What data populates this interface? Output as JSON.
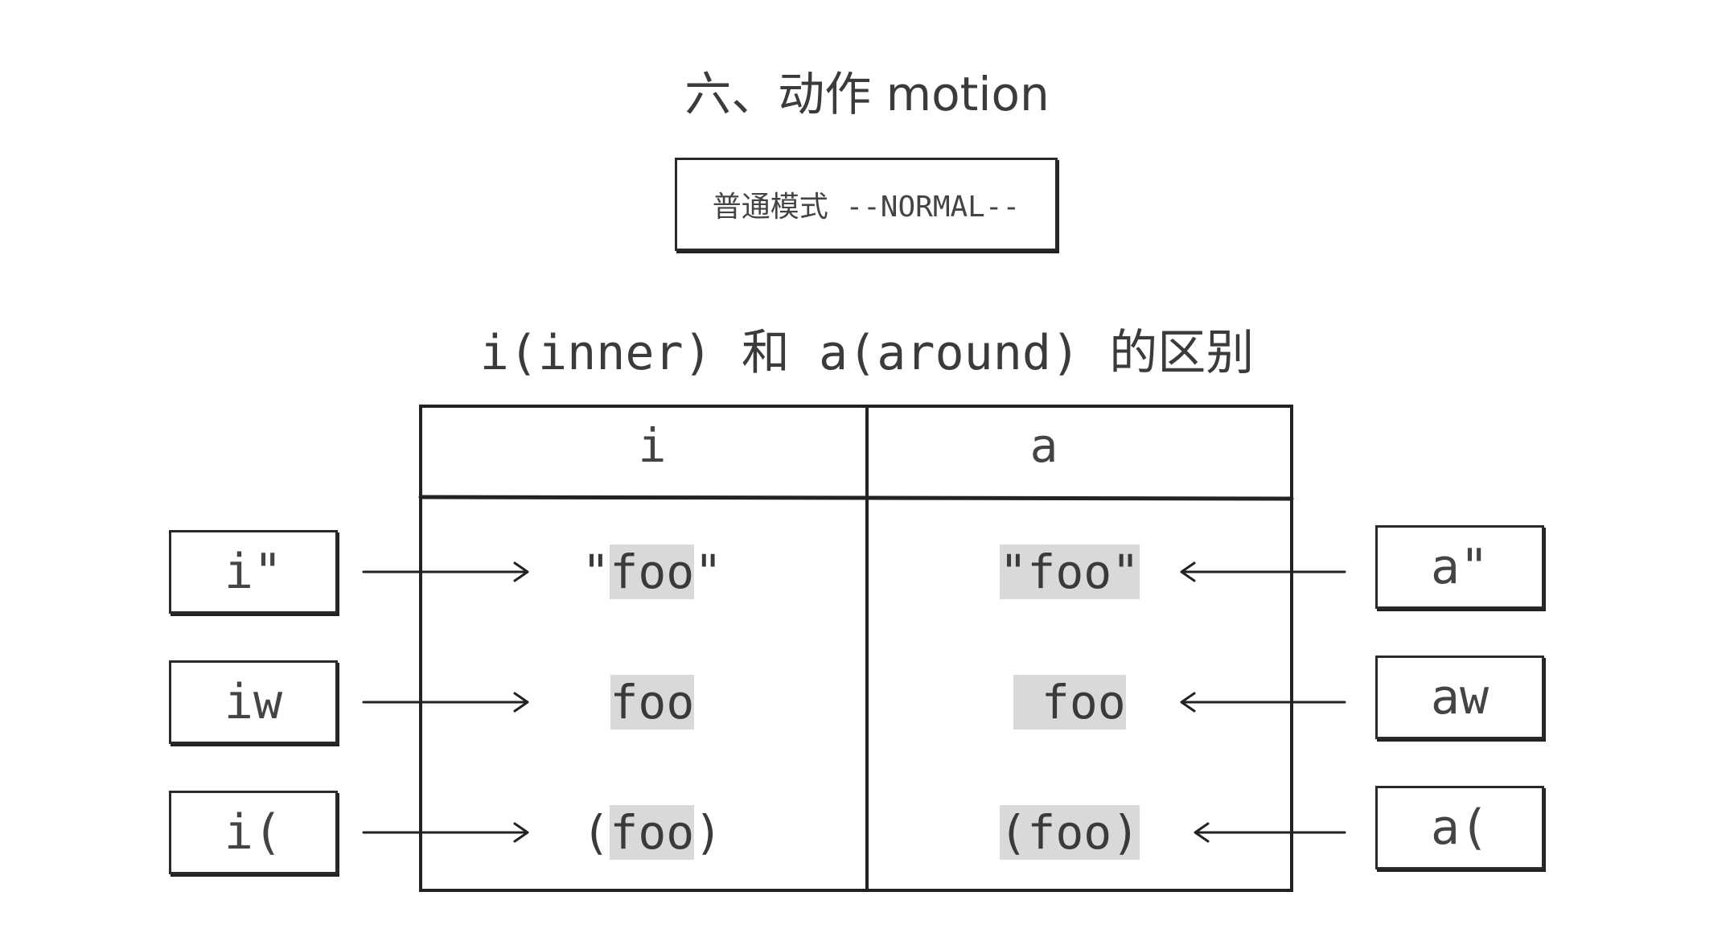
{
  "title": "六、动作 motion",
  "mode_label": "普通模式 --NORMAL--",
  "subtitle": "i(inner) 和 a(around) 的区别",
  "table": {
    "headers": [
      "i",
      "a"
    ],
    "rows": [
      {
        "left_key": "i\"",
        "right_key": "a\"",
        "i_cell": {
          "before": "\"",
          "highlight": "foo",
          "after": "\""
        },
        "a_cell": {
          "before": "",
          "highlight": "\"foo\"",
          "after": ""
        }
      },
      {
        "left_key": "iw",
        "right_key": "aw",
        "i_cell": {
          "before": "",
          "highlight": "foo",
          "after": ""
        },
        "a_cell": {
          "before": "",
          "highlight": " foo",
          "after": ""
        }
      },
      {
        "left_key": "i(",
        "right_key": "a(",
        "i_cell": {
          "before": "(",
          "highlight": "foo",
          "after": ")"
        },
        "a_cell": {
          "before": "",
          "highlight": "(foo)",
          "after": ""
        }
      }
    ]
  },
  "colors": {
    "highlight": "#d9d9d9",
    "ink": "#2a2a2a"
  }
}
